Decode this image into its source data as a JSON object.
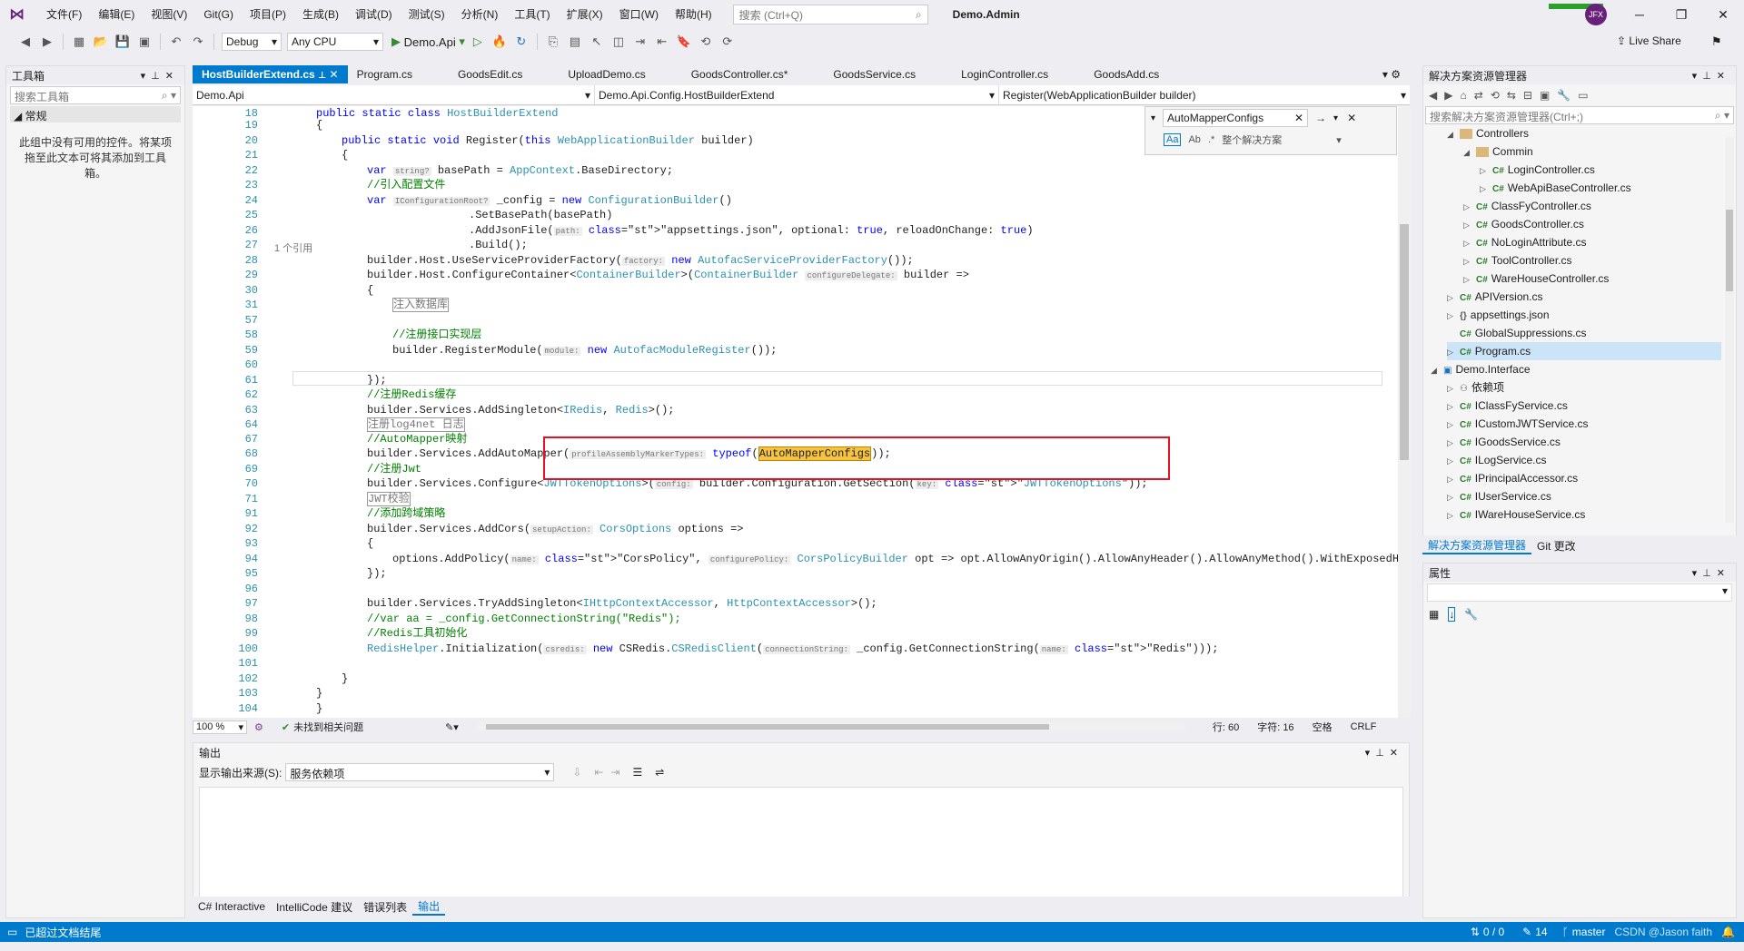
{
  "menubar": {
    "items": [
      "文件(F)",
      "编辑(E)",
      "视图(V)",
      "Git(G)",
      "项目(P)",
      "生成(B)",
      "调试(D)",
      "测试(S)",
      "分析(N)",
      "工具(T)",
      "扩展(X)",
      "窗口(W)",
      "帮助(H)"
    ],
    "search_placeholder": "搜索 (Ctrl+Q)",
    "solution_name": "Demo.Admin",
    "avatar": "JFX"
  },
  "toolbar": {
    "config": "Debug",
    "platform": "Any CPU",
    "run_target": "Demo.Api",
    "live_share": "Live Share"
  },
  "toolbox": {
    "title": "工具箱",
    "search_placeholder": "搜索工具箱",
    "group": "常规",
    "empty_text": "此组中没有可用的控件。将某项拖至此文本可将其添加到工具箱。"
  },
  "tabs": [
    {
      "label": "HostBuilderExtend.cs",
      "active": true
    },
    {
      "label": "Program.cs"
    },
    {
      "label": "GoodsEdit.cs"
    },
    {
      "label": "UploadDemo.cs"
    },
    {
      "label": "GoodsController.cs*"
    },
    {
      "label": "GoodsService.cs"
    },
    {
      "label": "LoginController.cs"
    },
    {
      "label": "GoodsAdd.cs"
    }
  ],
  "navbar": {
    "project": "Demo.Api",
    "class": "Demo.Api.Config.HostBuilderExtend",
    "member": "Register(WebApplicationBuilder builder)"
  },
  "find": {
    "query": "AutoMapperConfigs",
    "scope": "整个解决方案"
  },
  "editor": {
    "zoom": "100 %",
    "issues": "未找到相关问题",
    "line": "行: 60",
    "col": "字符: 16",
    "spaces": "空格",
    "eol": "CRLF",
    "refs": "1 个引用",
    "lines": [
      {
        "n": "18",
        "t": "public static class HostBuilderExtend"
      },
      {
        "n": "19",
        "t": "{"
      },
      {
        "n": "20",
        "t": "public static void Register(this WebApplicationBuilder builder)"
      },
      {
        "n": "21",
        "t": "{"
      },
      {
        "n": "22",
        "t": "var string? basePath = AppContext.BaseDirectory;"
      },
      {
        "n": "23",
        "t": "//引入配置文件"
      },
      {
        "n": "24",
        "t": "var IConfigurationRoot? _config = new ConfigurationBuilder()"
      },
      {
        "n": "25",
        "t": ".SetBasePath(basePath)"
      },
      {
        "n": "26",
        "t": ".AddJsonFile(path: \"appsettings.json\", optional: true, reloadOnChange: true)"
      },
      {
        "n": "27",
        "t": ".Build();"
      },
      {
        "n": "28",
        "t": "builder.Host.UseServiceProviderFactory(factory: new AutofacServiceProviderFactory());"
      },
      {
        "n": "29",
        "t": "builder.Host.ConfigureContainer<ContainerBuilder>(ContainerBuilder configureDelegate: builder =>"
      },
      {
        "n": "30",
        "t": "{"
      },
      {
        "n": "31",
        "t": "注入数据库"
      },
      {
        "n": "57",
        "t": ""
      },
      {
        "n": "58",
        "t": "//注册接口实现层"
      },
      {
        "n": "59",
        "t": "builder.RegisterModule(module: new AutofacModuleRegister());"
      },
      {
        "n": "60",
        "t": ""
      },
      {
        "n": "61",
        "t": "});"
      },
      {
        "n": "62",
        "t": "//注册Redis缓存"
      },
      {
        "n": "63",
        "t": "builder.Services.AddSingleton<IRedis, Redis>();"
      },
      {
        "n": "64",
        "t": "注册log4net 日志"
      },
      {
        "n": "67",
        "t": "//AutoMapper映射"
      },
      {
        "n": "68",
        "t": "builder.Services.AddAutoMapper(profileAssemblyMarkerTypes: typeof(AutoMapperConfigs));"
      },
      {
        "n": "69",
        "t": "//注册Jwt"
      },
      {
        "n": "70",
        "t": "builder.Services.Configure<JWTTokenOptions>(config: builder.Configuration.GetSection(key: \"JWTTokenOptions\"));"
      },
      {
        "n": "71",
        "t": "JWT校验"
      },
      {
        "n": "91",
        "t": "//添加跨域策略"
      },
      {
        "n": "92",
        "t": "builder.Services.AddCors(setupAction: CorsOptions options =>"
      },
      {
        "n": "93",
        "t": "{"
      },
      {
        "n": "94",
        "t": "options.AddPolicy(name: \"CorsPolicy\", configurePolicy: CorsPolicyBuilder opt => opt.AllowAnyOrigin().AllowAnyHeader().AllowAnyMethod().WithExposedHeaders(exposedHeaders: \"X-"
      },
      {
        "n": "95",
        "t": "});"
      },
      {
        "n": "96",
        "t": ""
      },
      {
        "n": "97",
        "t": "builder.Services.TryAddSingleton<IHttpContextAccessor, HttpContextAccessor>();"
      },
      {
        "n": "98",
        "t": "//var aa = _config.GetConnectionString(\"Redis\");"
      },
      {
        "n": "99",
        "t": "//Redis工具初始化"
      },
      {
        "n": "100",
        "t": "RedisHelper.Initialization(csredis: new CSRedis.CSRedisClient(connectionString: _config.GetConnectionString(name: \"Redis\")));"
      },
      {
        "n": "101",
        "t": ""
      },
      {
        "n": "102",
        "t": "}"
      },
      {
        "n": "103",
        "t": "}"
      },
      {
        "n": "104",
        "t": "}"
      }
    ]
  },
  "output": {
    "title": "输出",
    "source_label": "显示输出来源(S):",
    "source_value": "服务依赖项",
    "tabs": [
      "C# Interactive",
      "IntelliCode 建议",
      "错误列表",
      "输出"
    ]
  },
  "solution": {
    "title": "解决方案资源管理器",
    "search_placeholder": "搜索解决方案资源管理器(Ctrl+;)",
    "rows": [
      "Controllers",
      "Commin",
      "LoginController.cs",
      "WebApiBaseController.cs",
      "ClassFyController.cs",
      "GoodsController.cs",
      "NoLoginAttribute.cs",
      "ToolController.cs",
      "WareHouseController.cs",
      "APIVersion.cs",
      "appsettings.json",
      "GlobalSuppressions.cs",
      "Program.cs",
      "Demo.Interface",
      "依赖项",
      "IClassFyService.cs",
      "ICustomJWTService.cs",
      "IGoodsService.cs",
      "ILogService.cs",
      "IPrincipalAccessor.cs",
      "IUserService.cs",
      "IWareHouseService.cs"
    ],
    "tabs": [
      "解决方案资源管理器",
      "Git 更改"
    ]
  },
  "properties": {
    "title": "属性"
  },
  "status": {
    "left": "已超过文档结尾",
    "errors": "0 / 0",
    "edits": "14",
    "branch": "master",
    "watermark": "CSDN @Jason faith"
  },
  "colors": {
    "accent": "#007acc",
    "highlight_box": "#e81123"
  }
}
